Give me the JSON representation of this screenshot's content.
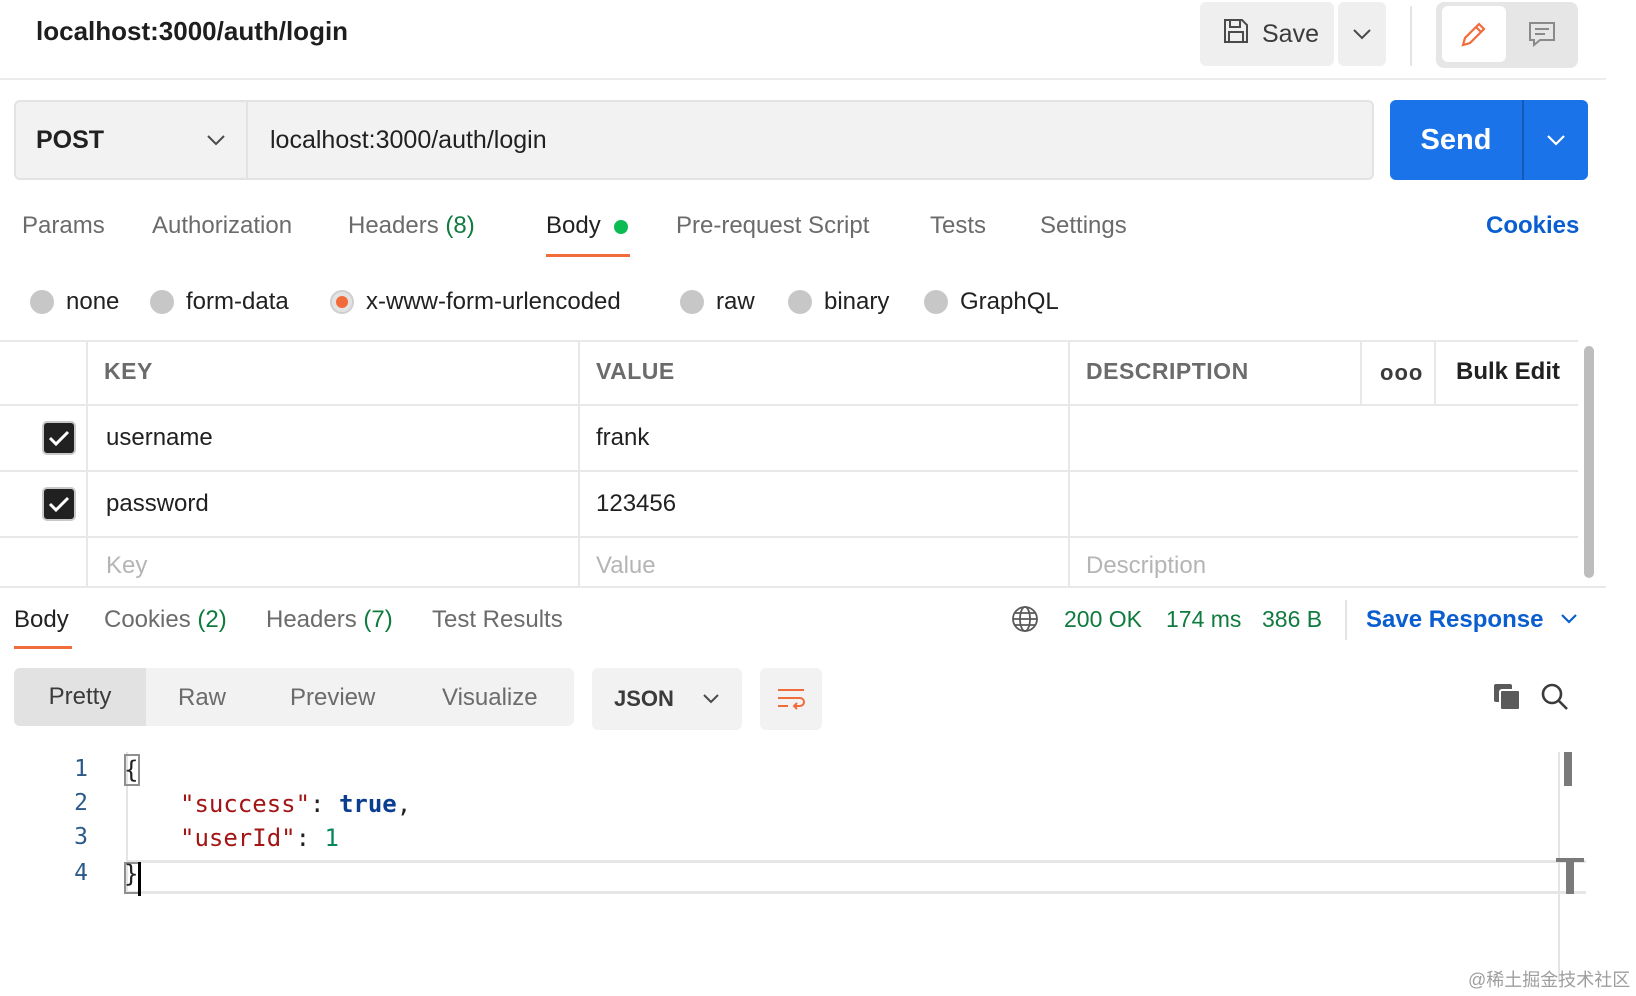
{
  "header": {
    "title": "localhost:3000/auth/login",
    "save_label": "Save"
  },
  "request": {
    "method": "POST",
    "url": "localhost:3000/auth/login",
    "send_label": "Send"
  },
  "request_tabs": {
    "params": "Params",
    "authorization": "Authorization",
    "headers": "Headers",
    "headers_count": "(8)",
    "body": "Body",
    "pre_request": "Pre-request Script",
    "tests": "Tests",
    "settings": "Settings",
    "cookies": "Cookies",
    "active": "Body"
  },
  "body_types": {
    "options": [
      "none",
      "form-data",
      "x-www-form-urlencoded",
      "raw",
      "binary",
      "GraphQL"
    ],
    "selected": "x-www-form-urlencoded"
  },
  "params_table": {
    "headers": {
      "key": "KEY",
      "value": "VALUE",
      "description": "DESCRIPTION",
      "more": "ooo",
      "bulk_edit": "Bulk Edit"
    },
    "rows": [
      {
        "checked": true,
        "key": "username",
        "value": "frank",
        "description": ""
      },
      {
        "checked": true,
        "key": "password",
        "value": "123456",
        "description": ""
      }
    ],
    "placeholder": {
      "key": "Key",
      "value": "Value",
      "description": "Description"
    }
  },
  "response": {
    "tabs": {
      "body": "Body",
      "cookies": "Cookies",
      "cookies_count": "(2)",
      "headers": "Headers",
      "headers_count": "(7)",
      "test_results": "Test Results"
    },
    "status": "200 OK",
    "time": "174 ms",
    "size": "386 B",
    "save_response": "Save Response",
    "view_modes": [
      "Pretty",
      "Raw",
      "Preview",
      "Visualize"
    ],
    "active_view": "Pretty",
    "format": "JSON",
    "code_lines": [
      {
        "num": "1",
        "text": "{"
      },
      {
        "num": "2",
        "key": "\"success\"",
        "sep": ": ",
        "value": "true",
        "tail": ","
      },
      {
        "num": "3",
        "key": "\"userId\"",
        "sep": ": ",
        "value": "1"
      },
      {
        "num": "4",
        "text": "}"
      }
    ]
  },
  "watermark": "@稀土掘金技术社区",
  "colors": {
    "accent": "#f26b3a",
    "send_blue": "#1a73e8",
    "link_blue": "#0a5ecf",
    "status_green": "#0f7b3f",
    "body_dot": "#0cbb52"
  }
}
